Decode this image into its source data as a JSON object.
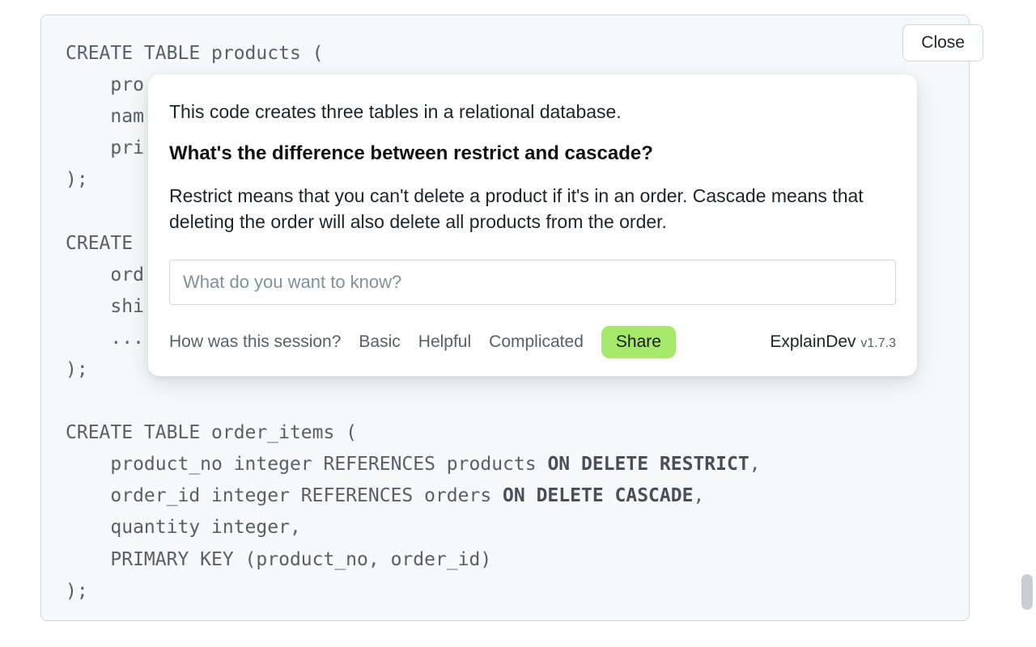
{
  "close_label": "Close",
  "code_lines": [
    {
      "t": "CREATE TABLE products ("
    },
    {
      "t": "    pro"
    },
    {
      "t": "    nam"
    },
    {
      "t": "    pri"
    },
    {
      "t": ");"
    },
    {
      "t": ""
    },
    {
      "t": "CREATE"
    },
    {
      "t": "    ord"
    },
    {
      "t": "    shi"
    },
    {
      "t": "    ..."
    },
    {
      "t": ");"
    },
    {
      "t": ""
    },
    {
      "t": "CREATE TABLE order_items ("
    },
    {
      "t": "    product_no integer REFERENCES products ",
      "b": "ON DELETE RESTRICT",
      "tail": ","
    },
    {
      "t": "    order_id integer REFERENCES orders ",
      "b": "ON DELETE CASCADE",
      "tail": ","
    },
    {
      "t": "    quantity integer,"
    },
    {
      "t": "    PRIMARY KEY (product_no, order_id)"
    },
    {
      "t": ");"
    }
  ],
  "popup": {
    "intro": "This code creates three tables in a relational database.",
    "question": "What's the difference between restrict and cascade?",
    "answer": "Restrict means that you can't delete a product if it's in an order. Cascade means that deleting the order will also delete all products from the order.",
    "input_placeholder": "What do you want to know?",
    "feedback_label": "How was this session?",
    "ratings": [
      "Basic",
      "Helpful",
      "Complicated"
    ],
    "share_label": "Share",
    "brand": "ExplainDev",
    "version": "v1.7.3"
  }
}
